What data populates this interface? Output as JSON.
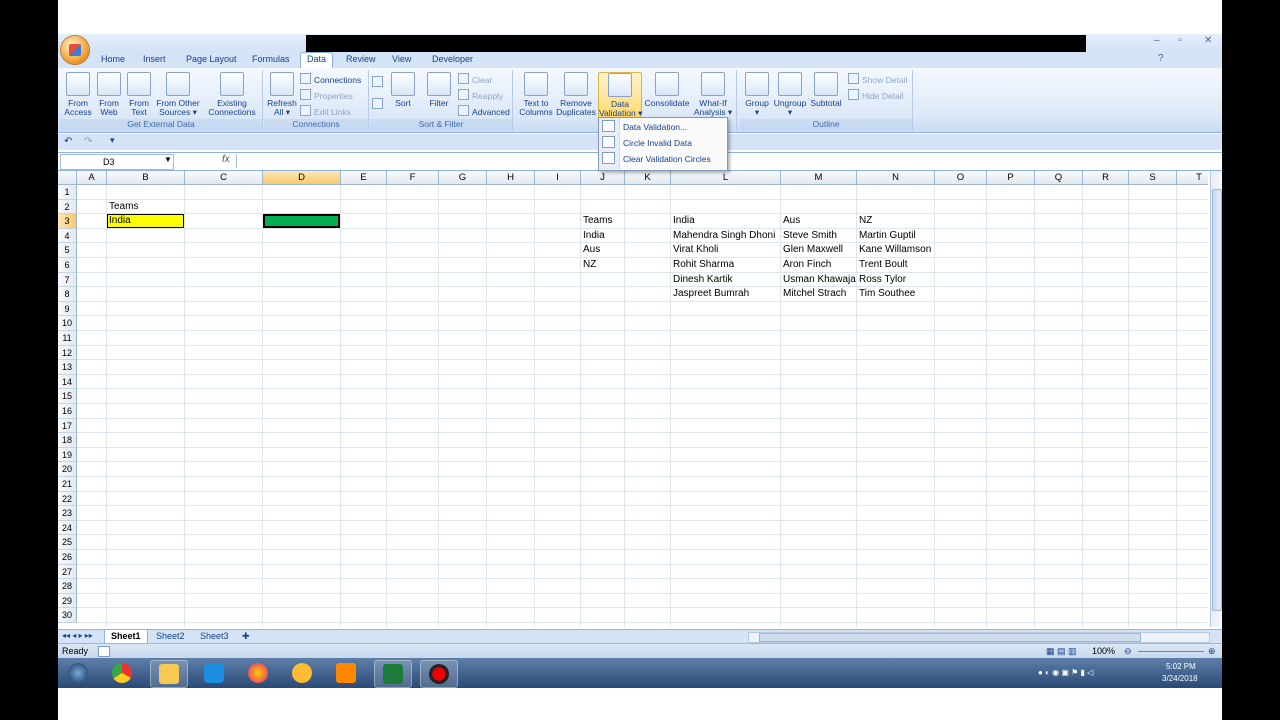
{
  "tabs": [
    "Home",
    "Insert",
    "Page Layout",
    "Formulas",
    "Data",
    "Review",
    "View",
    "Developer"
  ],
  "ribbon": {
    "get_external": {
      "label": "Get External Data",
      "buttons": [
        "From\nAccess",
        "From\nWeb",
        "From\nText",
        "From Other\nSources ▾",
        "Existing\nConnections"
      ]
    },
    "connections": {
      "label": "Connections",
      "refresh": "Refresh\nAll ▾",
      "small": [
        "Connections",
        "Properties",
        "Edit Links"
      ]
    },
    "sort_filter": {
      "label": "Sort & Filter",
      "sort": "Sort",
      "filter": "Filter",
      "small": [
        "Clear",
        "Reapply",
        "Advanced"
      ]
    },
    "data_tools": {
      "text_to_columns": "Text to\nColumns",
      "remove_duplicates": "Remove\nDuplicates",
      "data_validation": "Data\nValidation ▾",
      "consolidate": "Consolidate",
      "what_if": "What-If\nAnalysis ▾"
    },
    "outline": {
      "label": "Outline",
      "buttons": [
        "Group\n▾",
        "Ungroup\n▾",
        "Subtotal"
      ],
      "small": [
        "Show Detail",
        "Hide Detail"
      ]
    }
  },
  "menu": {
    "items": [
      "Data Validation...",
      "Circle Invalid Data",
      "Clear Validation Circles"
    ]
  },
  "formula_bar": {
    "name_box": "D3",
    "fx": "fx",
    "value": ""
  },
  "columns": [
    "A",
    "B",
    "C",
    "D",
    "E",
    "F",
    "G",
    "H",
    "I",
    "J",
    "K",
    "L",
    "M",
    "N",
    "O",
    "P",
    "Q",
    "R",
    "S",
    "T"
  ],
  "selected_column": "D",
  "rows": [
    "1",
    "2",
    "3",
    "4",
    "5",
    "6",
    "7",
    "8",
    "9",
    "10",
    "11",
    "12",
    "13",
    "14",
    "15",
    "16",
    "17",
    "18",
    "19",
    "20",
    "21",
    "22",
    "23",
    "24",
    "25",
    "26",
    "27",
    "28",
    "29",
    "30"
  ],
  "selected_row": "3",
  "cells": {
    "B2": "Teams",
    "B3": "India",
    "J3": "Teams",
    "J4": "India",
    "J5": "Aus",
    "J6": "NZ",
    "L3": "India",
    "L4": "Mahendra Singh Dhoni",
    "L5": "Virat Kholi",
    "L6": "Rohit Sharma",
    "L7": "Dinesh Kartik",
    "L8": "Jaspreet Bumrah",
    "M3": "Aus",
    "M4": "Steve Smith",
    "M5": "Glen Maxwell",
    "M6": "Aron Finch",
    "M7": "Usman Khawaja",
    "M8": "Mitchel Strach",
    "N3": "NZ",
    "N4": "Martin Guptil",
    "N5": "Kane Willamson",
    "N6": "Trent Boult",
    "N7": "Ross Tylor",
    "N8": "Tim Southee"
  },
  "colors": {
    "B3_fill": "#ffff00",
    "D3_fill": "#00b050"
  },
  "sheets": [
    "Sheet1",
    "Sheet2",
    "Sheet3"
  ],
  "active_sheet": "Sheet1",
  "status": {
    "text": "Ready",
    "zoom": "100%"
  },
  "clock": {
    "time": "5:02 PM",
    "date": "3/24/2018"
  },
  "taskbar_icons": [
    "start-orb-icon",
    "chrome-icon",
    "file-explorer-icon",
    "skype-icon",
    "firefox-icon",
    "paint-icon",
    "media-icon",
    "excel-icon",
    "record-icon"
  ]
}
